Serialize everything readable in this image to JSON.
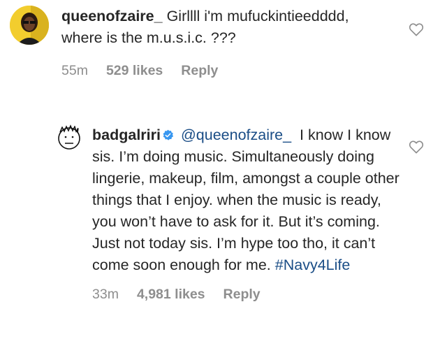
{
  "comments": [
    {
      "username": "queenofzaire_",
      "text": "Girllll i'm mufuckintieedddd, where is the m.u.s.i.c. ???",
      "time": "55m",
      "likes": "529 likes",
      "reply": "Reply",
      "avatar_icon": "profile-photo-icon"
    },
    {
      "username": "badgalriri",
      "verified": true,
      "mention": "@queenofzaire_",
      "text": "I know I know sis. I’m doing music. Simultaneously doing lingerie, makeup, film, amongst a couple other things that I enjoy. when the music is ready, you won’t have to ask for it. But it’s coming. Just not today sis. I’m hype too tho, it can’t come soon enough for me.",
      "hashtag": "#Navy4Life",
      "time": "33m",
      "likes": "4,981 likes",
      "reply": "Reply",
      "avatar_icon": "sketch-face-avatar-icon"
    }
  ],
  "colors": {
    "text": "#262626",
    "meta": "#8e8e8e",
    "link": "#1a4d86",
    "verified": "#3897f0"
  }
}
